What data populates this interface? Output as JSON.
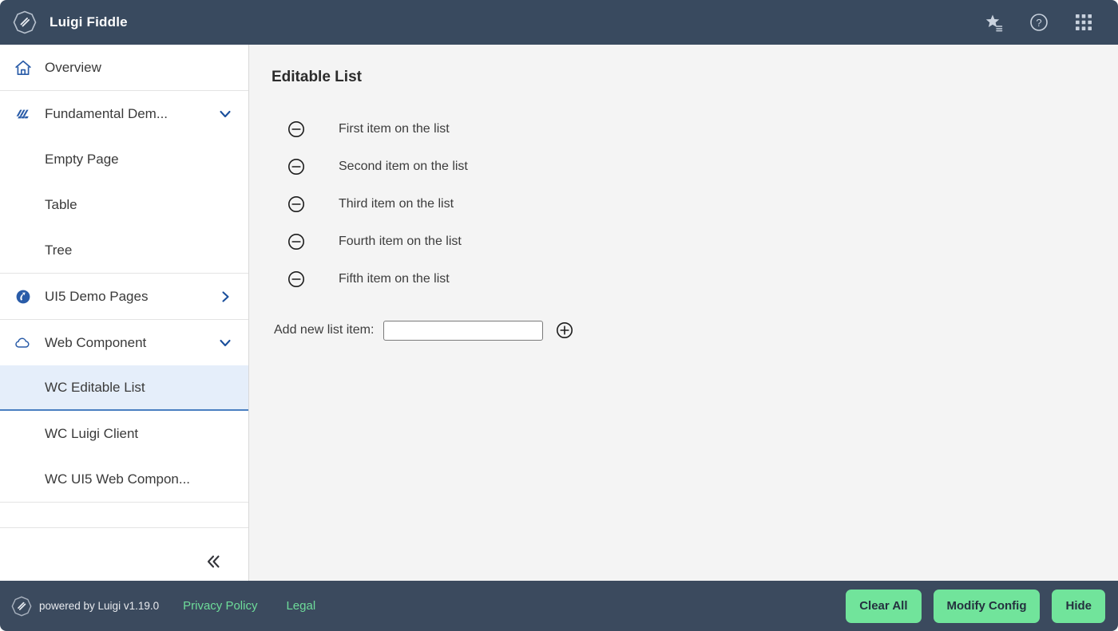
{
  "header": {
    "logo_icon": "luigi-octagon-logo",
    "title": "Luigi Fiddle",
    "actions": [
      {
        "name": "bookmarks-icon",
        "icon": "star-list-icon",
        "label": "Bookmarks"
      },
      {
        "name": "help-icon",
        "icon": "question-circle-icon",
        "label": "Help"
      },
      {
        "name": "app-launcher-icon",
        "icon": "grid-3x3-icon",
        "label": "App Launcher"
      }
    ]
  },
  "sidebar": {
    "groups": [
      {
        "items": [
          {
            "label": "Overview",
            "icon": "home-icon",
            "type": "top",
            "chevron": "none",
            "selected": false
          }
        ]
      },
      {
        "items": [
          {
            "label": "Fundamental Dem...",
            "icon": "layers-icon",
            "type": "top",
            "chevron": "down",
            "selected": false
          },
          {
            "label": "Empty Page",
            "icon": "",
            "type": "sub",
            "chevron": "none",
            "selected": false
          },
          {
            "label": "Table",
            "icon": "",
            "type": "sub",
            "chevron": "none",
            "selected": false
          },
          {
            "label": "Tree",
            "icon": "",
            "type": "sub",
            "chevron": "none",
            "selected": false
          }
        ]
      },
      {
        "items": [
          {
            "label": "UI5 Demo Pages",
            "icon": "ui5-logo-icon",
            "type": "top",
            "chevron": "right",
            "selected": false
          }
        ]
      },
      {
        "items": [
          {
            "label": "Web Component",
            "icon": "cloud-icon",
            "type": "top",
            "chevron": "down",
            "selected": false
          },
          {
            "label": "WC Editable List",
            "icon": "",
            "type": "sub",
            "chevron": "none",
            "selected": true
          },
          {
            "label": "WC Luigi Client",
            "icon": "",
            "type": "sub",
            "chevron": "none",
            "selected": false
          },
          {
            "label": "WC UI5 Web Compon...",
            "icon": "",
            "type": "sub",
            "chevron": "none",
            "selected": false
          }
        ]
      }
    ],
    "collapse_button": {
      "name": "collapse-sidebar-button",
      "icon": "chevron-double-left-icon"
    },
    "selected_bg": "#e5eefa",
    "selected_underline": "#4a7fc1"
  },
  "main": {
    "title": "Editable List",
    "items": [
      {
        "text": "First item on the list",
        "remove_icon": "minus-circle-icon"
      },
      {
        "text": "Second item on the list",
        "remove_icon": "minus-circle-icon"
      },
      {
        "text": "Third item on the list",
        "remove_icon": "minus-circle-icon"
      },
      {
        "text": "Fourth item on the list",
        "remove_icon": "minus-circle-icon"
      },
      {
        "text": "Fifth item on the list",
        "remove_icon": "minus-circle-icon"
      }
    ],
    "add_row": {
      "label": "Add new list item:",
      "input_value": "",
      "input_placeholder": "",
      "add_icon": "plus-circle-icon"
    }
  },
  "footer": {
    "logo_icon": "luigi-octagon-logo",
    "powered_by": "powered by Luigi v1.19.0",
    "links": [
      {
        "label": "Privacy Policy"
      },
      {
        "label": "Legal"
      }
    ],
    "buttons": [
      {
        "label": "Clear All"
      },
      {
        "label": "Modify Config"
      },
      {
        "label": "Hide"
      }
    ],
    "link_color": "#6edc9a",
    "button_color": "#71e49b"
  },
  "colors": {
    "topbar_bg": "#394a5f",
    "footer_bg": "#3b4a5e",
    "content_bg": "#f4f4f4",
    "sidebar_bg": "#ffffff",
    "nav_icon_blue": "#2a5ca8"
  }
}
